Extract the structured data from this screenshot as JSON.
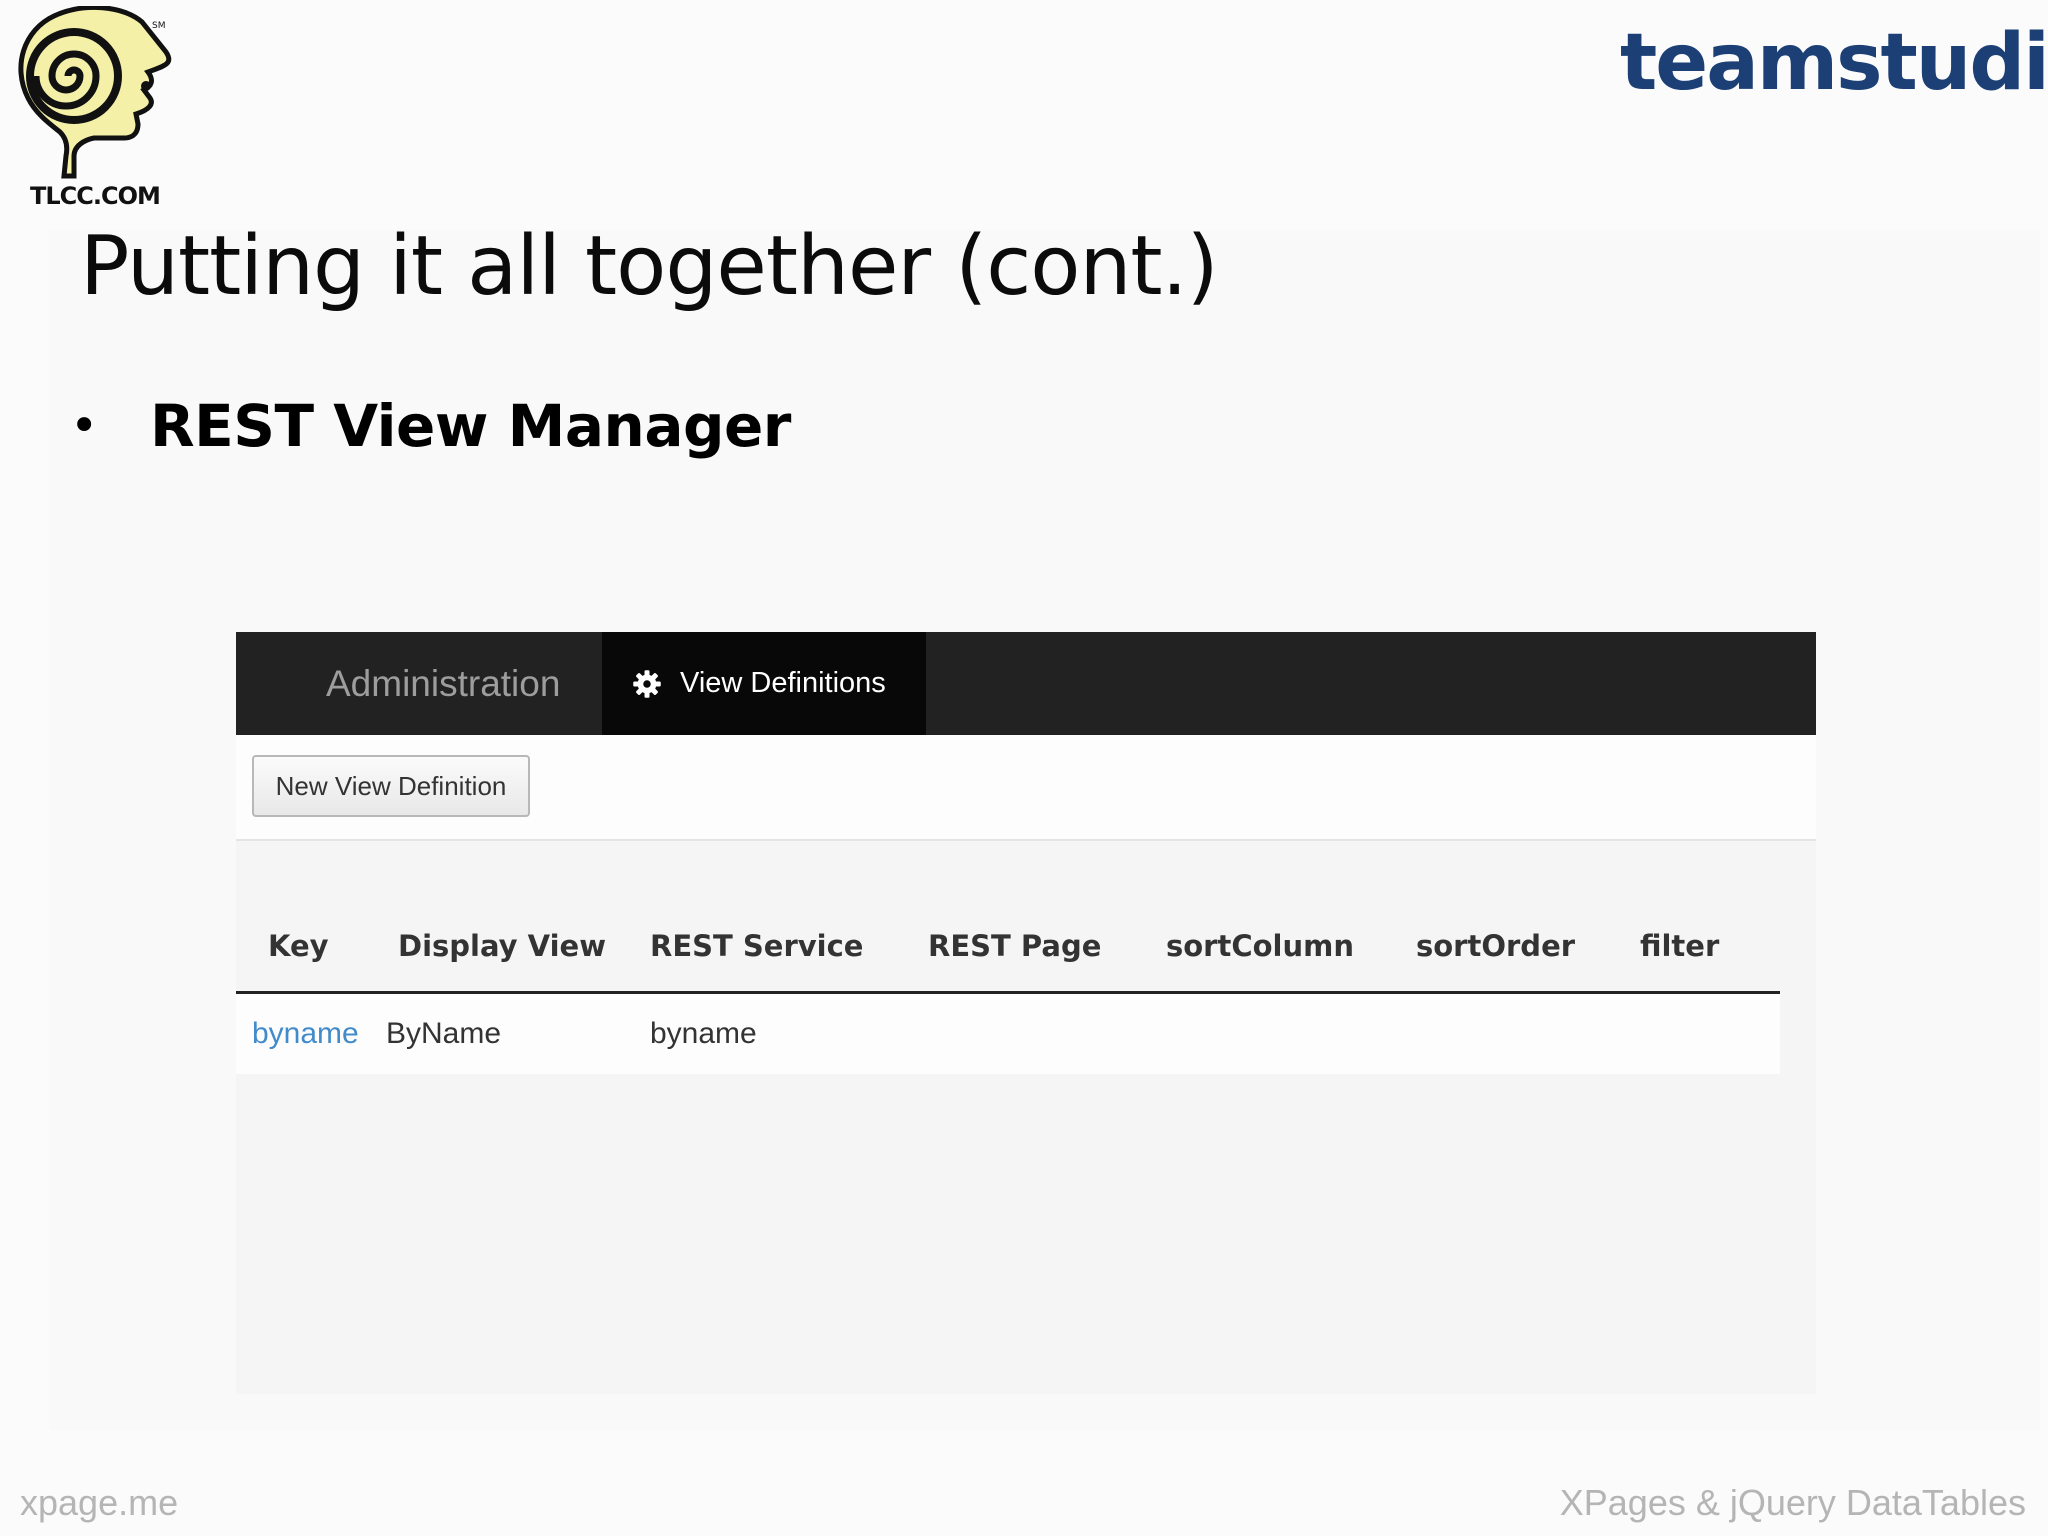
{
  "logos": {
    "left_text": "TLCC.COM",
    "right_text": "teamstudio",
    "right_mark": "®"
  },
  "slide": {
    "title": "Putting it all together (cont.)",
    "bullet": "REST View Manager"
  },
  "app": {
    "navbar": {
      "brand": "Administration",
      "active_tab": {
        "icon": "gear-icon",
        "label": "View Definitions"
      }
    },
    "toolbar": {
      "new_button_label": "New View Definition"
    },
    "table": {
      "columns": [
        "Key",
        "Display View",
        "REST Service",
        "REST Page",
        "sortColumn",
        "sortOrder",
        "filter"
      ],
      "rows": [
        {
          "key": "byname",
          "display_view": "ByName",
          "rest_service": "byname",
          "rest_page": "",
          "sort_column": "",
          "sort_order": "",
          "filter": ""
        }
      ]
    }
  },
  "footer": {
    "left": "xpage.me",
    "right": "XPages & jQuery DataTables"
  },
  "colors": {
    "navbar": "#222222",
    "active_tab": "#080808",
    "link": "#428bca",
    "brand_blue": "#1c3f76"
  }
}
